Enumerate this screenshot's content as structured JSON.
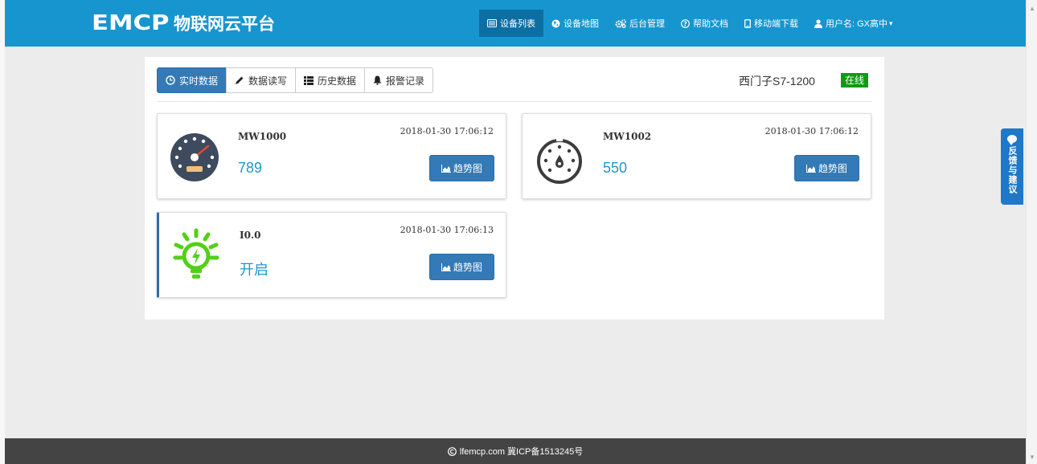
{
  "brand": {
    "logo": "EMCP",
    "name": "物联网云平台"
  },
  "nav": [
    {
      "label": "设备列表",
      "icon": "list-icon"
    },
    {
      "label": "设备地图",
      "icon": "globe-icon"
    },
    {
      "label": "后台管理",
      "icon": "gears-icon"
    },
    {
      "label": "帮助文档",
      "icon": "help-icon"
    },
    {
      "label": "移动端下载",
      "icon": "mobile-icon"
    },
    {
      "label": "用户名: GX高中",
      "icon": "user-icon"
    }
  ],
  "tabs": [
    {
      "label": "实时数据",
      "icon": "clock-icon"
    },
    {
      "label": "数据读写",
      "icon": "pencil-icon"
    },
    {
      "label": "历史数据",
      "icon": "list-icon"
    },
    {
      "label": "报警记录",
      "icon": "bell-icon"
    }
  ],
  "device": {
    "name": "西门子S7-1200",
    "status": "在线"
  },
  "cards": [
    {
      "label": "MW1000",
      "value": "789",
      "time": "2018-01-30 17:06:12",
      "button": "趋势图",
      "icon": "speedometer-icon"
    },
    {
      "label": "MW1002",
      "value": "550",
      "time": "2018-01-30 17:06:12",
      "button": "趋势图",
      "icon": "pressure-gauge-icon"
    },
    {
      "label": "I0.0",
      "value": "开启",
      "time": "2018-01-30 17:06:13",
      "button": "趋势图",
      "icon": "lightbulb-icon"
    }
  ],
  "feedback": {
    "label": "反馈与建议"
  },
  "footer": {
    "text": "lfemcp.com 冀ICP备1513245号"
  },
  "colors": {
    "nav": "#1795cf",
    "accent": "#337ab7",
    "online": "#0f9a12",
    "value": "#2196c9",
    "bulb": "#52d017",
    "gauge_dark": "#3e4a5d"
  }
}
